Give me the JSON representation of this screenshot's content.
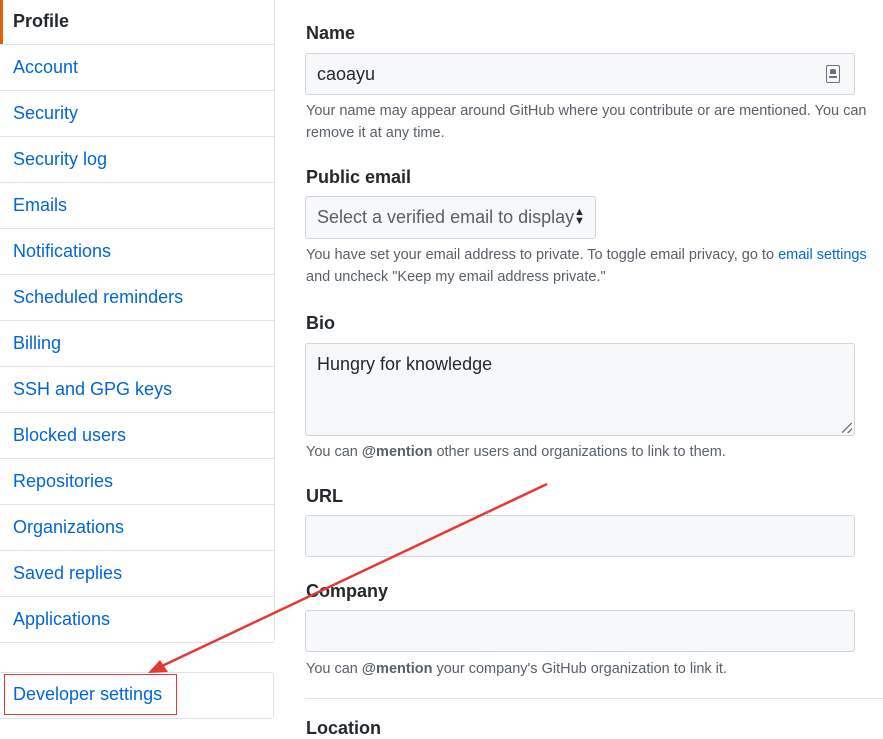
{
  "sidebar": {
    "items": [
      {
        "label": "Profile",
        "selected": true
      },
      {
        "label": "Account"
      },
      {
        "label": "Security"
      },
      {
        "label": "Security log"
      },
      {
        "label": "Emails"
      },
      {
        "label": "Notifications"
      },
      {
        "label": "Scheduled reminders"
      },
      {
        "label": "Billing"
      },
      {
        "label": "SSH and GPG keys"
      },
      {
        "label": "Blocked users"
      },
      {
        "label": "Repositories"
      },
      {
        "label": "Organizations"
      },
      {
        "label": "Saved replies"
      },
      {
        "label": "Applications"
      }
    ],
    "developer_settings": "Developer settings"
  },
  "form": {
    "name": {
      "label": "Name",
      "value": "caoayu",
      "help": "Your name may appear around GitHub where you contribute or are mentioned. You can remove it at any time."
    },
    "public_email": {
      "label": "Public email",
      "selected": "Select a verified email to display",
      "help_before": "You have set your email address to private. To toggle email privacy, go to ",
      "help_link": "email settings",
      "help_after": " and uncheck \"Keep my email address private.\""
    },
    "bio": {
      "label": "Bio",
      "value": "Hungry for knowledge",
      "help_before": "You can ",
      "help_mention": "@mention",
      "help_after": " other users and organizations to link to them."
    },
    "url": {
      "label": "URL",
      "value": ""
    },
    "company": {
      "label": "Company",
      "value": "",
      "help_before": "You can ",
      "help_mention": "@mention",
      "help_after": " your company's GitHub organization to link it."
    },
    "location": {
      "label": "Location"
    }
  },
  "colors": {
    "link": "#0366d6",
    "selected_accent": "#e36209",
    "annotation": "#e53935"
  }
}
